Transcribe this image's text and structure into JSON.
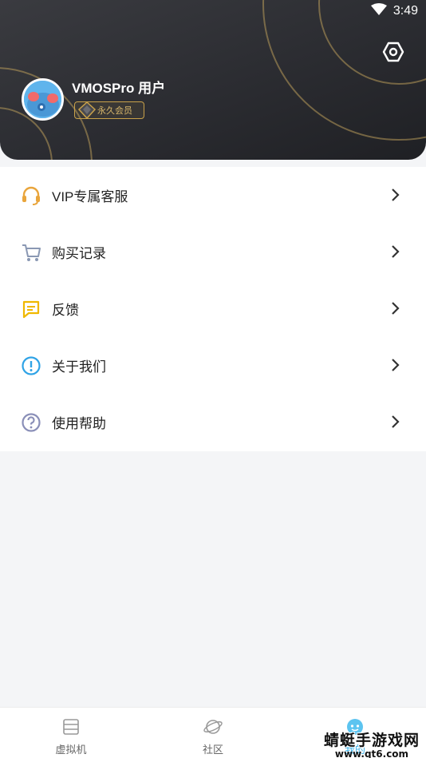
{
  "status_bar": {
    "time": "3:49"
  },
  "profile": {
    "username": "VMOSPro 用户",
    "membership_badge": "永久会员"
  },
  "menu": {
    "items": [
      {
        "label": "VIP专属客服",
        "icon": "headset-icon",
        "color": "#e9a53c"
      },
      {
        "label": "购买记录",
        "icon": "cart-icon",
        "color": "#8a98b3"
      },
      {
        "label": "反馈",
        "icon": "message-icon",
        "color": "#f0b800"
      },
      {
        "label": "关于我们",
        "icon": "info-icon",
        "color": "#2fa3e6"
      },
      {
        "label": "使用帮助",
        "icon": "help-icon",
        "color": "#8a8fb8"
      }
    ]
  },
  "bottom_nav": {
    "items": [
      {
        "label": "虚拟机",
        "icon": "vm-icon"
      },
      {
        "label": "社区",
        "icon": "planet-icon"
      },
      {
        "label": "我的",
        "icon": "profile-face-icon",
        "active": true
      }
    ]
  },
  "watermark": {
    "main": "蜻蜓手游戏网",
    "sub": "www.qt6.com"
  },
  "colors": {
    "header_dark": "#2b2c31",
    "gold": "#c8a14a",
    "accent": "#3ab0e8"
  }
}
